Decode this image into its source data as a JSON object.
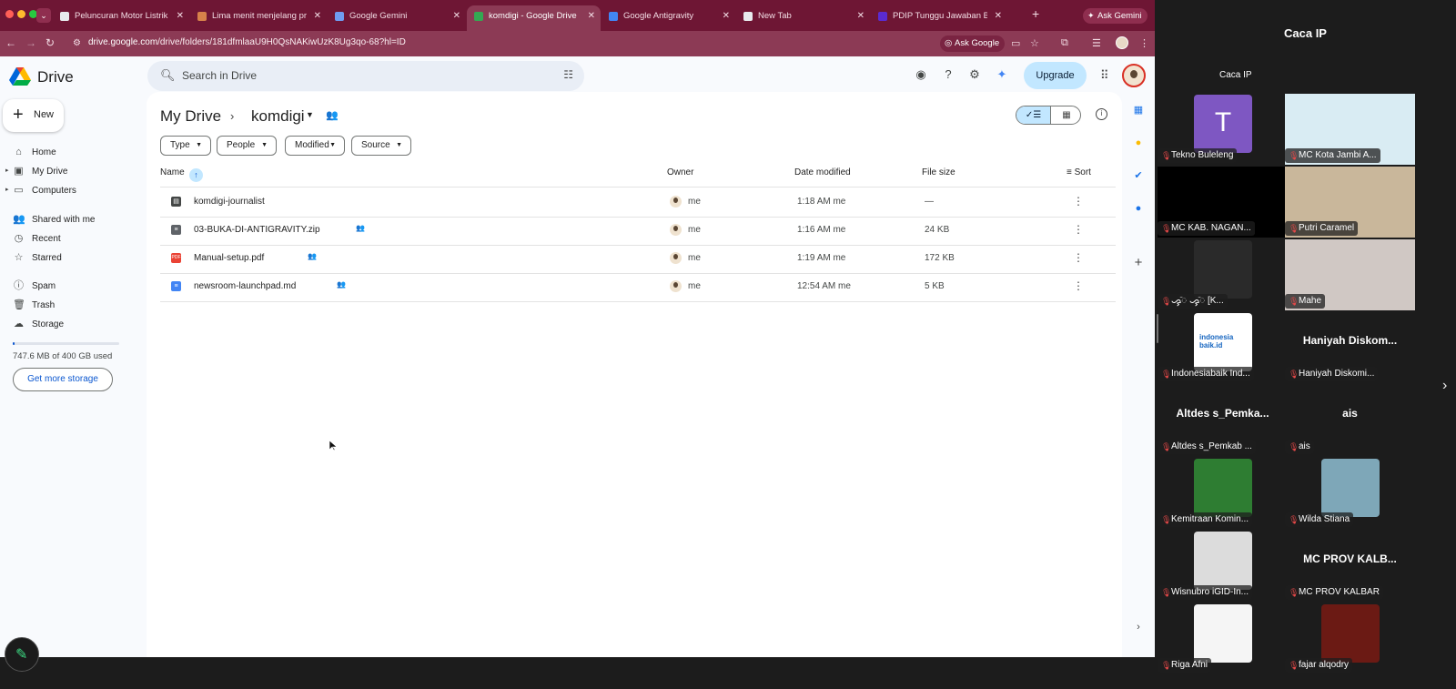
{
  "browser": {
    "tabs": [
      {
        "title": "Peluncuran Motor Listrik",
        "active": false,
        "fav_color": "#e8eaed"
      },
      {
        "title": "Lima menit menjelang prokl",
        "active": false,
        "fav_color": "#d6814a"
      },
      {
        "title": "Google Gemini",
        "active": false,
        "fav_color": "#6f9cf0"
      },
      {
        "title": "komdigi - Google Drive",
        "active": true,
        "fav_color": "#34a853"
      },
      {
        "title": "Google Antigravity",
        "active": false,
        "fav_color": "#4285f4"
      },
      {
        "title": "New Tab",
        "active": false,
        "fav_color": "#e8eaed"
      },
      {
        "title": "PDIP Tunggu Jawaban BGN",
        "active": false,
        "fav_color": "#5b2bd1"
      }
    ],
    "ask_gemini_label": "Ask Gemini",
    "url_host": "drive.google.com",
    "url_path": "/drive/folders/181dfmlaaU9H0QsNAKiwUzK8Ug3qo-68?hl=ID",
    "ask_google_label": "Ask Google"
  },
  "drive": {
    "app_name": "Drive",
    "search_placeholder": "Search in Drive",
    "upgrade_label": "Upgrade",
    "new_label": "New",
    "sidebar": [
      {
        "label": "Home",
        "icon": "home-icon",
        "glyph": "⌂"
      },
      {
        "label": "My Drive",
        "icon": "my-drive-icon",
        "glyph": "▣"
      },
      {
        "label": "Computers",
        "icon": "computers-icon",
        "glyph": "▭"
      },
      {
        "label": "Shared with me",
        "icon": "shared-icon",
        "glyph": "👥"
      },
      {
        "label": "Recent",
        "icon": "clock-icon",
        "glyph": "◷"
      },
      {
        "label": "Starred",
        "icon": "star-icon",
        "glyph": "☆"
      },
      {
        "label": "Spam",
        "icon": "spam-icon",
        "glyph": "ⓘ"
      },
      {
        "label": "Trash",
        "icon": "trash-icon",
        "glyph": "🗑"
      },
      {
        "label": "Storage",
        "icon": "cloud-icon",
        "glyph": "☁"
      }
    ],
    "storage_used_fraction": 0.0019,
    "storage_text": "747.6 MB of 400 GB used",
    "get_more_storage_label": "Get more storage",
    "breadcrumb": {
      "root": "My Drive",
      "current": "komdigi"
    },
    "filters": [
      "Type",
      "People",
      "Modified",
      "Source"
    ],
    "columns": {
      "name": "Name",
      "owner": "Owner",
      "modified": "Date modified",
      "size": "File size",
      "sort": "Sort"
    },
    "files": [
      {
        "name": "komdigi-journalist",
        "kind": "folder",
        "shared": false,
        "owner": "me",
        "modified": "1:18 AM me",
        "size": "—"
      },
      {
        "name": "03-BUKA-DI-ANTIGRAVITY.zip",
        "kind": "zip",
        "shared": true,
        "owner": "me",
        "modified": "1:16 AM me",
        "size": "24 KB"
      },
      {
        "name": "Manual-setup.pdf",
        "kind": "pdf",
        "shared": true,
        "owner": "me",
        "modified": "1:19 AM me",
        "size": "172 KB"
      },
      {
        "name": "newsroom-launchpad.md",
        "kind": "doc",
        "shared": true,
        "owner": "me",
        "modified": "12:54 AM me",
        "size": "5 KB"
      }
    ]
  },
  "meeting": {
    "title": "Caca IP",
    "participants": [
      {
        "name": "Caca IP",
        "type": "label-only"
      },
      {
        "name": "Tekno Buleleng",
        "type": "avatar-letter",
        "letter": "T",
        "color": "#7e57c2"
      },
      {
        "name": "MC Kota Jambi A...",
        "type": "image",
        "color": "#d9ecf3"
      },
      {
        "name": "MC KAB. NAGAN...",
        "type": "dark"
      },
      {
        "name": "Putri Caramel",
        "type": "image",
        "color": "#c9b79b"
      },
      {
        "name": "ᯀᯮᯩ ᯀᯮᯩ [K...",
        "type": "image",
        "color": "#2a2a2a"
      },
      {
        "name": "Mahe",
        "type": "image",
        "color": "#d0c8c4"
      },
      {
        "name": "Indonesiabaik Ind...",
        "type": "logo",
        "logo_text": "indonesia baik.id",
        "color": "#ffffff"
      },
      {
        "name": "Haniyah Diskomi...",
        "type": "text-only",
        "big": "Haniyah Diskom..."
      },
      {
        "name": "Altdes s_Pemkab ...",
        "type": "text-only",
        "big": "Altdes s_Pemka..."
      },
      {
        "name": "ais",
        "type": "text-only",
        "big": "ais"
      },
      {
        "name": "Kemitraan Komin...",
        "type": "image",
        "color": "#2e7d32"
      },
      {
        "name": "Wilda Stiana",
        "type": "image",
        "color": "#7ea7b8"
      },
      {
        "name": "Wisnubro iGID-In...",
        "type": "image",
        "color": "#dcdcdc"
      },
      {
        "name": "MC PROV KALBAR",
        "type": "text-only",
        "big": "MC PROV KALB..."
      },
      {
        "name": "Riga Afni",
        "type": "image",
        "color": "#f5f5f5"
      },
      {
        "name": "fajar alqodry",
        "type": "image",
        "color": "#6b1a14"
      }
    ]
  }
}
